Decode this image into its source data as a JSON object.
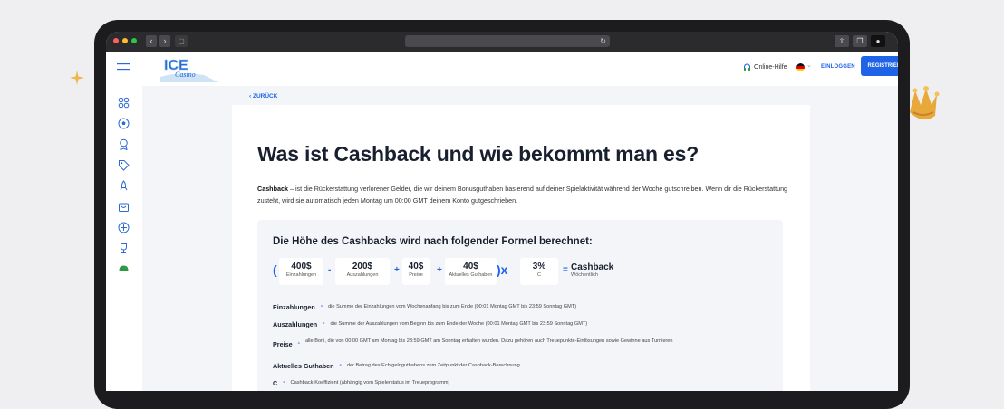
{
  "header": {
    "help_label": "Online-Hilfe",
    "login_label": "EINLOGGEN",
    "register_label": "REGISTRIEREN",
    "logo_text": "ICE",
    "logo_sub": "Casino"
  },
  "nav": {
    "back_label": "‹ ZURÜCK"
  },
  "article": {
    "title": "Was ist Cashback und wie bekommt man es?",
    "intro_term": "Cashback",
    "intro_text": " – ist die Rückerstattung verlorener Gelder, die wir deinem Bonusguthaben basierend auf deiner Spielaktivität während der Woche gutschreiben. Wenn dir die Rückerstattung zusteht, wird sie automatisch jeden Montag um 00:00 GMT deinem Konto gutgeschrieben."
  },
  "formula": {
    "heading": "Die Höhe des Cashbacks wird nach folgender Formel berechnet:",
    "open_paren": "(",
    "close_paren_times": ")x",
    "items": [
      {
        "value": "400$",
        "label": "Einzahlungen"
      },
      {
        "value": "200$",
        "label": "Auszahlungen"
      },
      {
        "value": "40$",
        "label": "Preise"
      },
      {
        "value": "40$",
        "label": "Aktuelles Guthaben"
      },
      {
        "value": "3%",
        "label": "C"
      }
    ],
    "ops": [
      "-",
      "+",
      "+",
      "="
    ],
    "result_value": "Cashback",
    "result_label": "Wöchentlich"
  },
  "definitions": [
    {
      "term": "Einzahlungen",
      "text": "die Summe der Einzahlungen vom Wochenanfang bis zum Ende (00:01 Montag GMT bis 23:59 Sonntag GMT)"
    },
    {
      "term": "Auszahlungen",
      "text": "die Summe der Auszahlungen vom Beginn bis zum Ende der Woche (00:01 Montag GMT bis 23:59 Sonntag GMT)"
    },
    {
      "term": "Preise",
      "text": "alle Boni, die von 00:00 GMT am Montag bis 23:59 GMT am Sonntag erhalten wurden. Dazu gehören auch Treuepunkte-Einlösungen sowie Gewinne aus Turnieren"
    },
    {
      "term": "Aktuelles Guthaben",
      "text": "der Betrag des Echtgeldguthabens zum Zeitpunkt der Cashback-Berechnung"
    },
    {
      "term": "C",
      "text": "Cashback-Koeffizient (abhängig vom Spielerstatus im Treueprogramm)"
    }
  ],
  "colors": {
    "accent": "#1f63e6",
    "sidebar_icon": "#2a6ad8",
    "active_icon": "#2e9a46"
  },
  "icons": [
    "menu-icon",
    "games-icon",
    "soccer-ball-icon",
    "award-icon",
    "tag-icon",
    "rocket-icon",
    "gift-icon",
    "slots-icon",
    "trophy-icon",
    "android-icon"
  ]
}
